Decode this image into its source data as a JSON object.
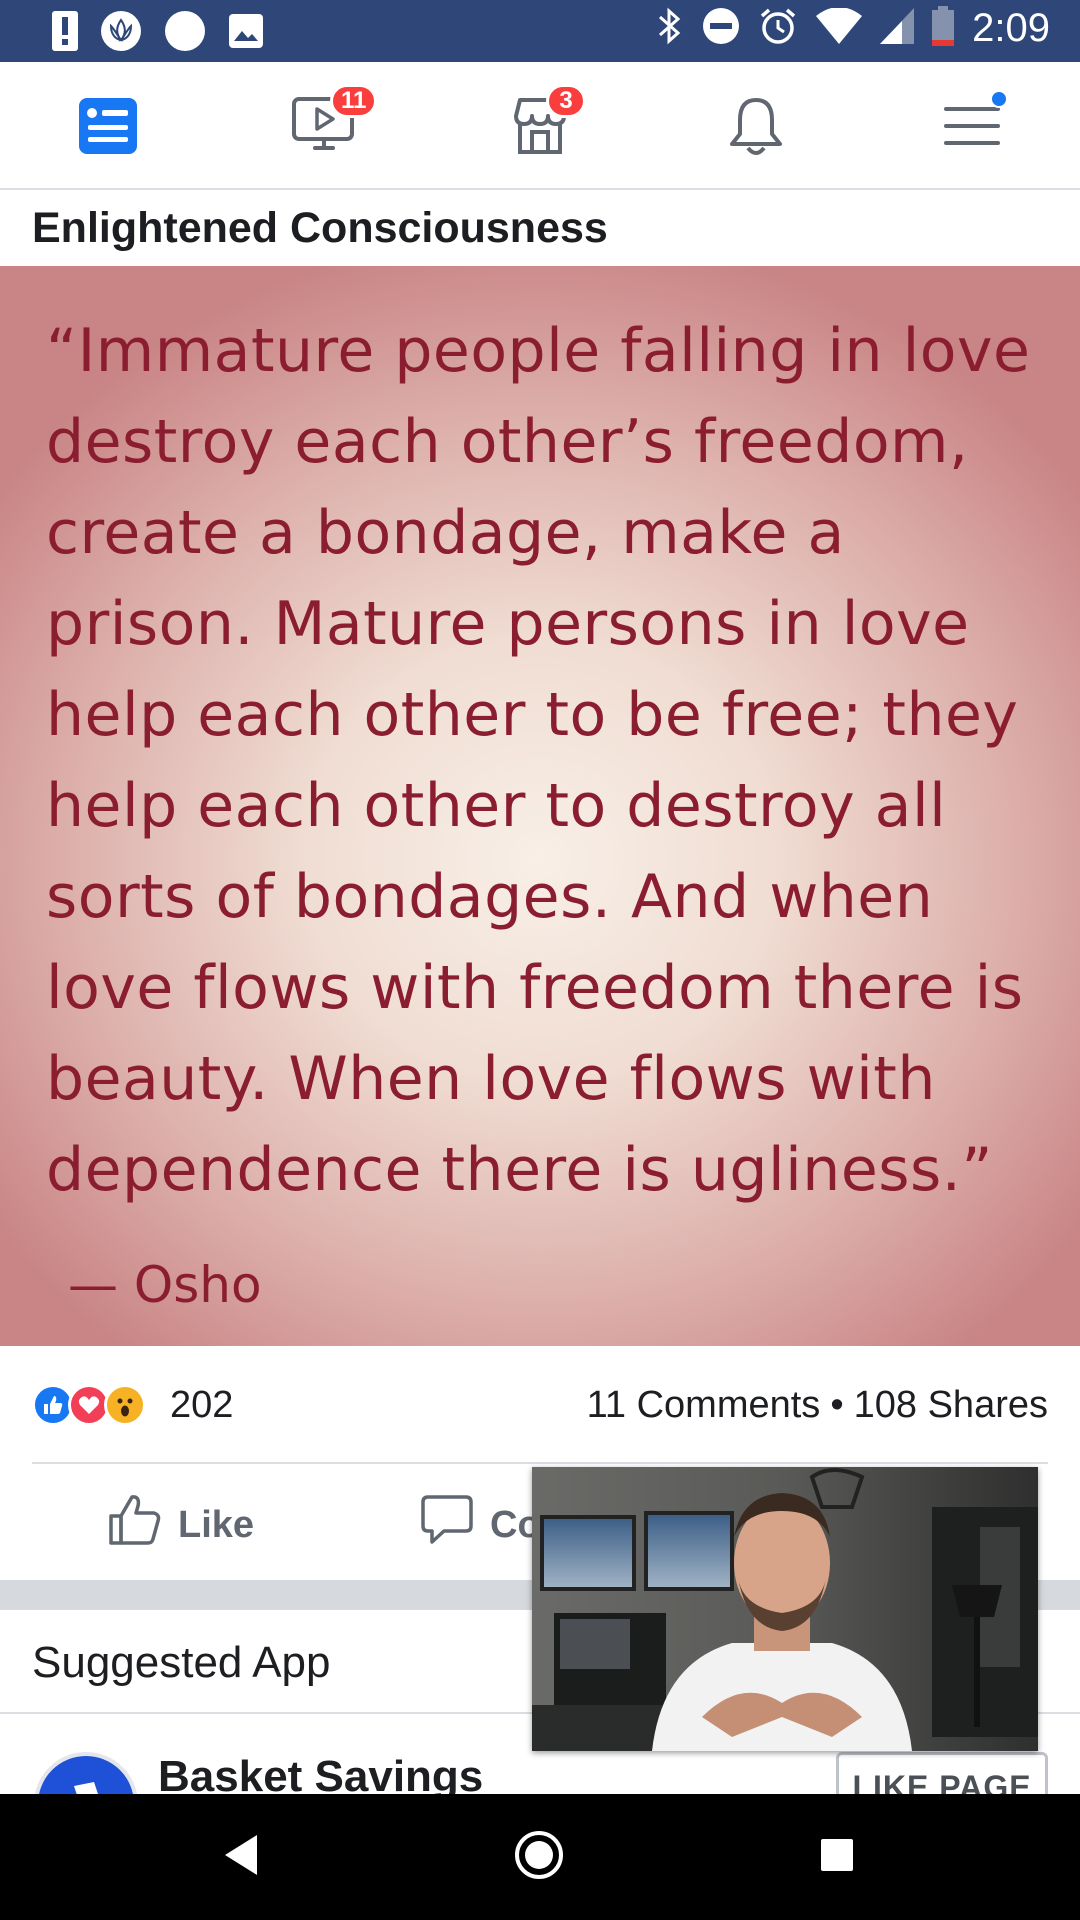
{
  "status_bar": {
    "time": "2:09",
    "left_icons": [
      "alert-icon",
      "lotus-app-icon",
      "circle-notification-icon",
      "image-icon"
    ],
    "right_icons": [
      "bluetooth-icon",
      "do-not-disturb-icon",
      "alarm-icon",
      "wifi-icon",
      "signal-icon",
      "battery-low-icon"
    ]
  },
  "top_nav": {
    "items": [
      {
        "name": "news-feed",
        "icon": "news-feed-icon",
        "active": true
      },
      {
        "name": "watch",
        "icon": "watch-icon",
        "badge": "11"
      },
      {
        "name": "marketplace",
        "icon": "marketplace-icon",
        "badge": "3"
      },
      {
        "name": "notifications",
        "icon": "bell-icon"
      },
      {
        "name": "menu",
        "icon": "menu-icon",
        "dot": true
      }
    ],
    "active_color": "#1877f2",
    "badge_color": "#fa3e3e"
  },
  "post": {
    "title": "Enlightened Consciousness",
    "quote_lines": "“Immature people falling in love\ndestroy each other’s freedom,\ncreate a bondage, make a\nprison. Mature persons in love\nhelp each other to be free; they\nhelp each other to destroy all\nsorts of bondages. And when\nlove flows with freedom there is\nbeauty. When love flows with\ndependence there is ugliness.”",
    "quote_author": "—  Osho",
    "quote_color": "#8b1d31",
    "reaction_count": "202",
    "comments": "11 Comments",
    "separator": "•",
    "shares": "108 Shares",
    "actions": {
      "like": "Like",
      "comment": "Co"
    }
  },
  "suggested": {
    "label": "Suggested App",
    "app_name": "Basket Savings",
    "like_page": "LIKE PAGE"
  },
  "android_nav": [
    "back-icon",
    "home-icon",
    "recents-icon"
  ]
}
